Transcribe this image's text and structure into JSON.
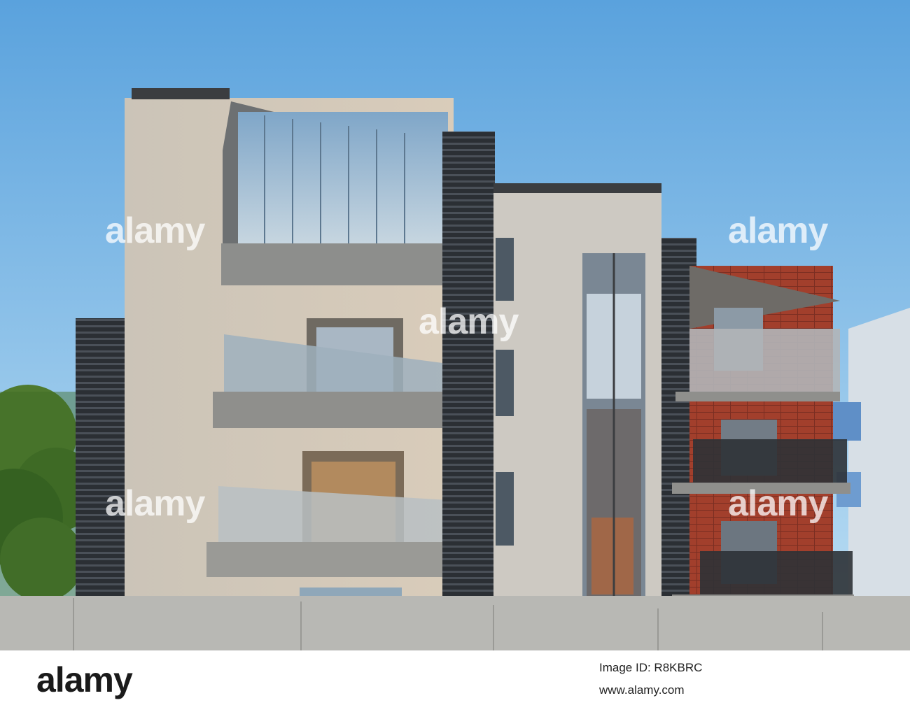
{
  "watermark": {
    "text": "alamy"
  },
  "footer": {
    "logo": "alamy",
    "image_id": "Image ID: R8KBRC",
    "site": "www.alamy.com"
  },
  "colors": {
    "sky_top": "#5fa4de",
    "sky_bottom": "#b8dcf3",
    "facade": "#d2c7b7",
    "brick": "#9c3d2c",
    "louver": "#2b2f34",
    "concrete": "#b7b7b3"
  }
}
